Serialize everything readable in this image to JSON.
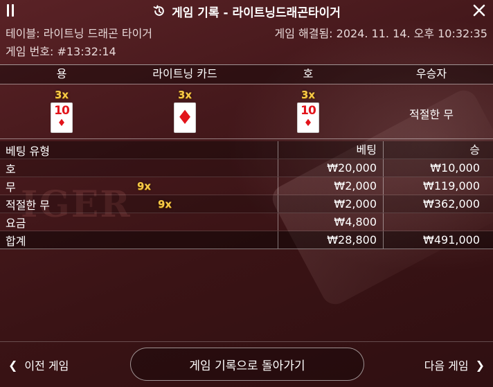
{
  "header": {
    "title": "게임 기록 - 라이트닝드래곤타이거"
  },
  "info": {
    "table_label": "테이블: 라이트닝 드래곤 타이거",
    "game_number_label": "게임 번호: #13:32:14",
    "resolved_label": "게임 해결됨: 2024. 11. 14. 오후 10:32:35"
  },
  "result": {
    "columns": [
      "용",
      "라이트닝 카드",
      "호",
      "우승자"
    ],
    "dragon": {
      "multiplier": "3x",
      "rank": "10",
      "suit": "♦"
    },
    "lightning": {
      "multiplier": "3x",
      "suit": "♦"
    },
    "tiger": {
      "multiplier": "3x",
      "rank": "10",
      "suit": "♦"
    },
    "winner": "적절한 무"
  },
  "bets": {
    "headers": {
      "type": "베팅 유형",
      "bet": "베팅",
      "win": "승"
    },
    "rows": [
      {
        "type": "호",
        "multiplier": "",
        "bet": "₩20,000",
        "win": "₩10,000"
      },
      {
        "type": "무",
        "multiplier": "9x",
        "bet": "₩2,000",
        "win": "₩119,000"
      },
      {
        "type": "적절한 무",
        "multiplier": "9x",
        "bet": "₩2,000",
        "win": "₩362,000"
      },
      {
        "type": "요금",
        "multiplier": "",
        "bet": "₩4,800",
        "win": ""
      }
    ],
    "total": {
      "type": "합계",
      "bet": "₩28,800",
      "win": "₩491,000"
    }
  },
  "footer": {
    "prev_label": "이전 게임",
    "back_label": "게임 기록으로 돌아가기",
    "next_label": "다음 게임"
  },
  "colors": {
    "background": "#3a1416",
    "multiplier_gold": "#f7c948",
    "card_red": "#e2141b"
  },
  "watermark_text": "IGER"
}
